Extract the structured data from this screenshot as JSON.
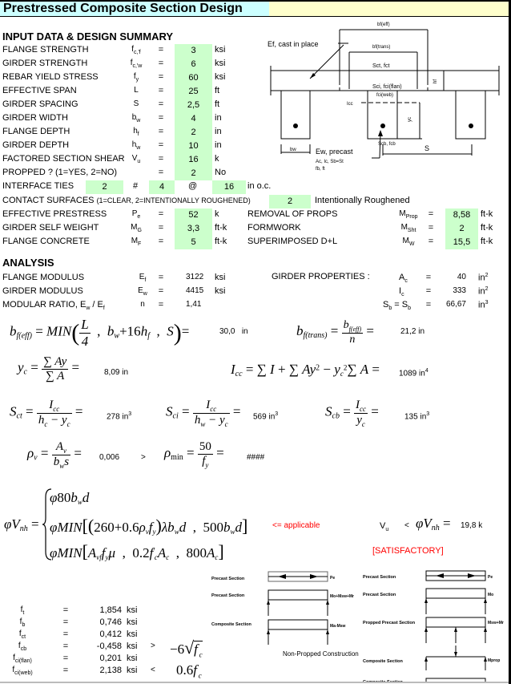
{
  "title": "Prestressed Composite Section Design",
  "input_section": {
    "heading": "INPUT DATA & DESIGN SUMMARY",
    "rows": [
      {
        "label": "FLANGE STRENGTH",
        "symbol": "f",
        "sub": "c,'f",
        "value": "3",
        "unit": "ksi"
      },
      {
        "label": "GIRDER STRENGTH",
        "symbol": "f",
        "sub": "c,'w",
        "value": "6",
        "unit": "ksi"
      },
      {
        "label": "REBAR YIELD STRESS",
        "symbol": "f",
        "sub": "y",
        "value": "60",
        "unit": "ksi"
      },
      {
        "label": "EFFECTIVE SPAN",
        "symbol": "L",
        "sub": "",
        "value": "25",
        "unit": "ft"
      },
      {
        "label": "GIRDER SPACING",
        "symbol": "S",
        "sub": "",
        "value": "2,5",
        "unit": "ft"
      },
      {
        "label": "GIRDER WIDTH",
        "symbol": "b",
        "sub": "w",
        "value": "4",
        "unit": "in"
      },
      {
        "label": "FLANGE DEPTH",
        "symbol": "h",
        "sub": "f",
        "value": "2",
        "unit": "in"
      },
      {
        "label": "GIRDER DEPTH",
        "symbol": "h",
        "sub": "w",
        "value": "10",
        "unit": "in"
      },
      {
        "label": "FACTORED SECTION SHEAR",
        "symbol": "V",
        "sub": "u",
        "value": "16",
        "unit": "k"
      },
      {
        "label": "PROPPED ? (1=YES, 2=NO)",
        "symbol": "",
        "sub": "",
        "value": "2",
        "unit": "No"
      }
    ],
    "eq": "=",
    "interface_ties": {
      "label": "INTERFACE TIES",
      "count": "2",
      "hash": "#",
      "bar": "4",
      "at": "@",
      "spacing": "16",
      "unit": "in o.c."
    },
    "contact": {
      "label": "CONTACT SURFACES",
      "note": "(1=CLEAR, 2=INTENTIONALLY ROUGHENED)",
      "value": "2",
      "desc": "Intentionally Roughened"
    },
    "loads_left": [
      {
        "label": "EFFECTIVE PRESTRESS",
        "symbol": "P",
        "sub": "e",
        "value": "52",
        "unit": "k"
      },
      {
        "label": "GIRDER SELF WEIGHT",
        "symbol": "M",
        "sub": "G",
        "value": "3,3",
        "unit": "ft-k"
      },
      {
        "label": "FLANGE CONCRETE",
        "symbol": "M",
        "sub": "F",
        "value": "5",
        "unit": "ft-k"
      }
    ],
    "loads_right": [
      {
        "label": "REMOVAL OF PROPS",
        "symbol": "M",
        "sub": "Prop",
        "value": "8,58",
        "unit": "ft-k"
      },
      {
        "label": "FORMWORK",
        "symbol": "M",
        "sub": "Sht",
        "value": "2",
        "unit": "ft-k"
      },
      {
        "label": "SUPERIMPOSED D+L",
        "symbol": "M",
        "sub": "W",
        "value": "15,5",
        "unit": "ft-k"
      }
    ]
  },
  "diagram": {
    "bf_eff": "bf(eff)",
    "bf_trans": "bf(trans)",
    "ef_label": "Ef, cast in place",
    "sct_fct": "Sct,  fct",
    "sci_fci": "Sci,  fci(flan)",
    "fci_web": "fci(web)",
    "hf": "hf",
    "icc": "Icc",
    "yc": "yc",
    "scb_fcb": "Scb,  fcb",
    "bw": "bw",
    "ew_label": "Ew, precast",
    "props1": "Ac,  Ic,  Sb=St",
    "props2": "fb,  ft",
    "s": "S"
  },
  "analysis": {
    "heading": "ANALYSIS",
    "rows": [
      {
        "label": "FLANGE MODULUS",
        "symbol": "E",
        "sub": "f",
        "value": "3122",
        "unit": "ksi"
      },
      {
        "label": "GIRDER MODULUS",
        "symbol": "E",
        "sub": "w",
        "value": "4415",
        "unit": "ksi"
      },
      {
        "label": "MODULAR RATIO, E",
        "label_sub": "w",
        "label_tail": " / E",
        "label_sub2": "f",
        "symbol": "n",
        "sub": "",
        "value": "1,41",
        "unit": ""
      }
    ],
    "girder_props_label": "GIRDER PROPERTIES :",
    "girder_props": [
      {
        "symbol": "A",
        "sub": "c",
        "value": "40",
        "unit": "in",
        "exp": "2"
      },
      {
        "symbol": "I",
        "sub": "c",
        "value": "333",
        "unit": "in",
        "exp": "2"
      },
      {
        "symbol": "S",
        "sub": "b",
        "symbol2": " = S",
        "sub2": "b",
        "value": "66,67",
        "unit": "in",
        "exp": "3"
      }
    ],
    "bf_eff": {
      "value": "30,0",
      "unit": "in"
    },
    "bf_trans": {
      "value": "21,2",
      "unit": "in"
    },
    "yc": {
      "value": "8,09",
      "unit": "in"
    },
    "icc": {
      "value": "1089",
      "unit": "in",
      "exp": "4"
    },
    "sct": {
      "value": "278",
      "unit": "in",
      "exp": "3"
    },
    "sci": {
      "value": "569",
      "unit": "in",
      "exp": "3"
    },
    "scb": {
      "value": "135",
      "unit": "in",
      "exp": "3"
    },
    "rho_v": {
      "value": "0,006"
    },
    "compare_gt": ">",
    "rho_min": {
      "value": "####"
    },
    "applicable": "<= applicable",
    "vu_label": "V",
    "vu_sub": "u",
    "vu_cmp": "<",
    "phi_vnh": {
      "value": "19,8",
      "unit": "k"
    },
    "status": "[SATISFACTORY]"
  },
  "stresses": [
    {
      "symbol": "f",
      "sub": "t",
      "value": "1,854",
      "unit": "ksi",
      "cmp": "",
      "limit": ""
    },
    {
      "symbol": "f",
      "sub": "b",
      "value": "0,746",
      "unit": "ksi",
      "cmp": "",
      "limit": ""
    },
    {
      "symbol": "f",
      "sub": "ct",
      "value": "0,412",
      "unit": "ksi",
      "cmp": "",
      "limit": ""
    },
    {
      "symbol": "f",
      "sub": "cb",
      "value": "-0,458",
      "unit": "ksi",
      "cmp": ">",
      "limit": "-6√f'c"
    },
    {
      "symbol": "f",
      "sub": "ci(flan)",
      "value": "0,201",
      "unit": "ksi",
      "cmp": "",
      "limit": ""
    },
    {
      "symbol": "f",
      "sub": "ci(web)",
      "value": "2,138",
      "unit": "ksi",
      "cmp": "<",
      "limit": "0.6f'c"
    }
  ],
  "construction_nonpropped": {
    "title": "Non-Propped Construction",
    "rows": [
      {
        "label": "Precast Section",
        "moment": "Pe"
      },
      {
        "label": "Precast Section",
        "moment": "Mo+Msw+Mr"
      },
      {
        "label": "Composite Section",
        "moment": "Ma-Msw"
      }
    ]
  },
  "construction_propped": {
    "rows": [
      {
        "label": "Precast Section",
        "moment": "Pe"
      },
      {
        "label": "Precast Section",
        "moment": "Mo"
      },
      {
        "label": "Propped Precast Section",
        "moment": "Msw+Mr"
      },
      {
        "label": "Composite Section",
        "moment": "Mprop"
      },
      {
        "label": "Composite Section",
        "moment": ""
      }
    ]
  }
}
